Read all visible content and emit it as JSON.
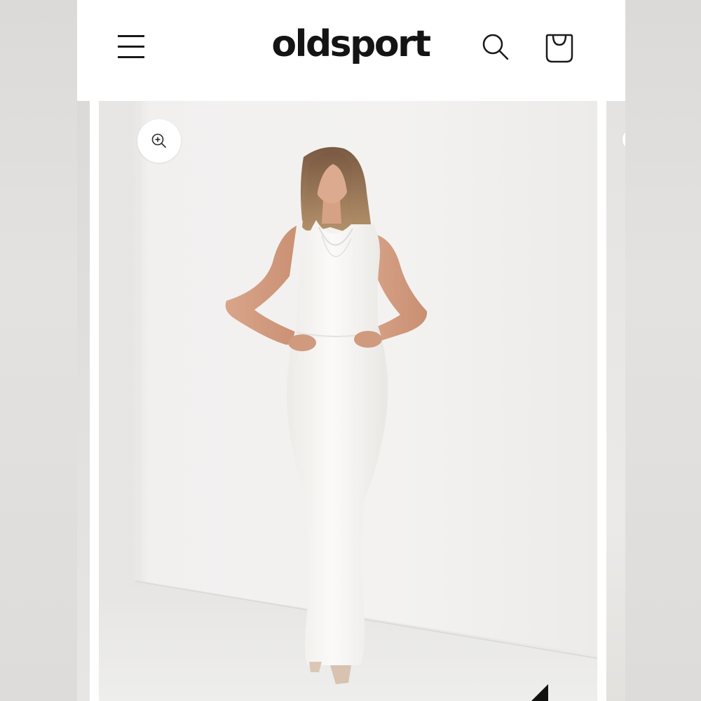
{
  "header": {
    "logo_text": "oldsport",
    "menu_icon": "hamburger-menu-icon",
    "search_icon": "search-icon",
    "cart_icon": "shopping-bag-icon"
  },
  "gallery": {
    "zoom_icon": "zoom-in-icon",
    "image_description_icon": "product-photo"
  },
  "colors": {
    "brand_text": "#141414",
    "background": "#ffffff",
    "dress": "#f7f6f3"
  }
}
